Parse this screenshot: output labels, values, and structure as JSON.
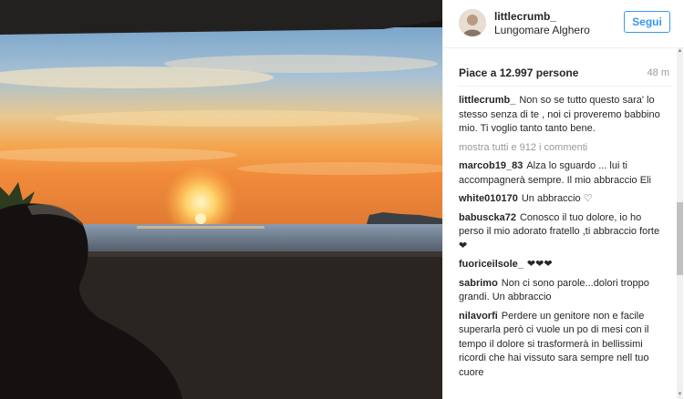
{
  "post": {
    "username": "littlecrumb_",
    "location": "Lungomare Alghero",
    "follow_label": "Segui",
    "likes": "Piace a 12.997 persone",
    "time": "48 m"
  },
  "caption": {
    "user": "littlecrumb_",
    "text": "Non so se tutto questo sara' lo stesso senza di te , noi ci proveremo babbino mio. Ti voglio tanto tanto bene."
  },
  "more_comments": "mostra tutti e 912 i commenti",
  "comments": [
    {
      "user": "marcob19_83",
      "text": "Alza lo sguardo ... lui ti accompagnerà sempre. Il mio abbraccio Eli"
    },
    {
      "user": "white010170",
      "text": "Un abbraccio ♡"
    },
    {
      "user": "babuscka72",
      "text": "Conosco il tuo dolore, io ho perso il mio adorato fratello ,ti abbraccio forte ❤"
    },
    {
      "user": "fuoriceilsole_",
      "text": "❤❤❤"
    },
    {
      "user": "sabrimo",
      "text": "Non ci sono parole...dolori troppo grandi. Un abbraccio"
    },
    {
      "user": "nilavorfi",
      "text": "Perdere un genitore non e facile superarla però ci vuole un po di mesi con il tempo il dolore si trasformerà in bellissimi ricordi che hai vissuto sara sempre nell tuo cuore"
    }
  ],
  "colors": {
    "accent": "#3897f0",
    "text": "#262626",
    "muted": "#999999"
  }
}
